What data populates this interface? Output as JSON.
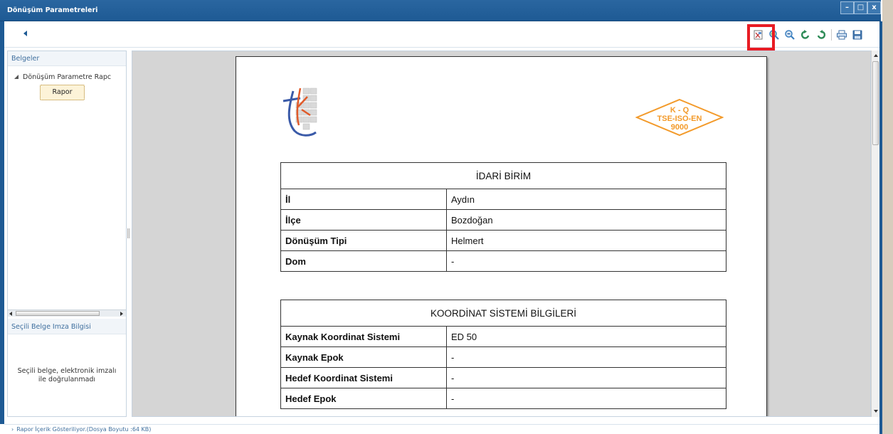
{
  "window": {
    "title": "Dönüşüm Parametreleri",
    "minimize": "–",
    "maximize": "□",
    "close": "x"
  },
  "toolbar": {
    "icons": [
      "pdf-icon",
      "zoom-in-icon",
      "zoom-out-icon",
      "rotate-left-icon",
      "rotate-right-icon",
      "print-icon",
      "save-icon"
    ]
  },
  "sidebar": {
    "header": "Belgeler",
    "tree_root": "Dönüşüm Parametre Rapc",
    "tree_child": "Rapor",
    "signature_header": "Seçili Belge Imza Bilgisi",
    "signature_line1": "Seçili belge, elektronik imzalı",
    "signature_line2": "ile doğrulanmadı"
  },
  "document": {
    "logo_right_lines": [
      "K - Q",
      "TSE-ISO-EN",
      "9000"
    ],
    "admin": {
      "title": "İDARİ BİRİM",
      "rows": [
        {
          "key": "İl",
          "value": "Aydın"
        },
        {
          "key": "İlçe",
          "value": "Bozdoğan"
        },
        {
          "key": "Dönüşüm Tipi",
          "value": "Helmert"
        },
        {
          "key": "Dom",
          "value": "-"
        }
      ]
    },
    "coord": {
      "title": "KOORDİNAT SİSTEMİ BİLGİLERİ",
      "rows": [
        {
          "key": "Kaynak Koordinat Sistemi",
          "value": "ED 50"
        },
        {
          "key": "Kaynak Epok",
          "value": "-"
        },
        {
          "key": "Hedef Koordinat Sistemi",
          "value": "-"
        },
        {
          "key": "Hedef Epok",
          "value": "-"
        }
      ]
    }
  },
  "status": {
    "text": "Rapor İçerik Gösteriliyor.(Dosya Boyutu :64 KB)"
  },
  "colors": {
    "title_bar": "#1e5a94",
    "highlight": "#e81c24",
    "logo_orange": "#f39a2a",
    "logo_blue": "#3a5aa8"
  }
}
